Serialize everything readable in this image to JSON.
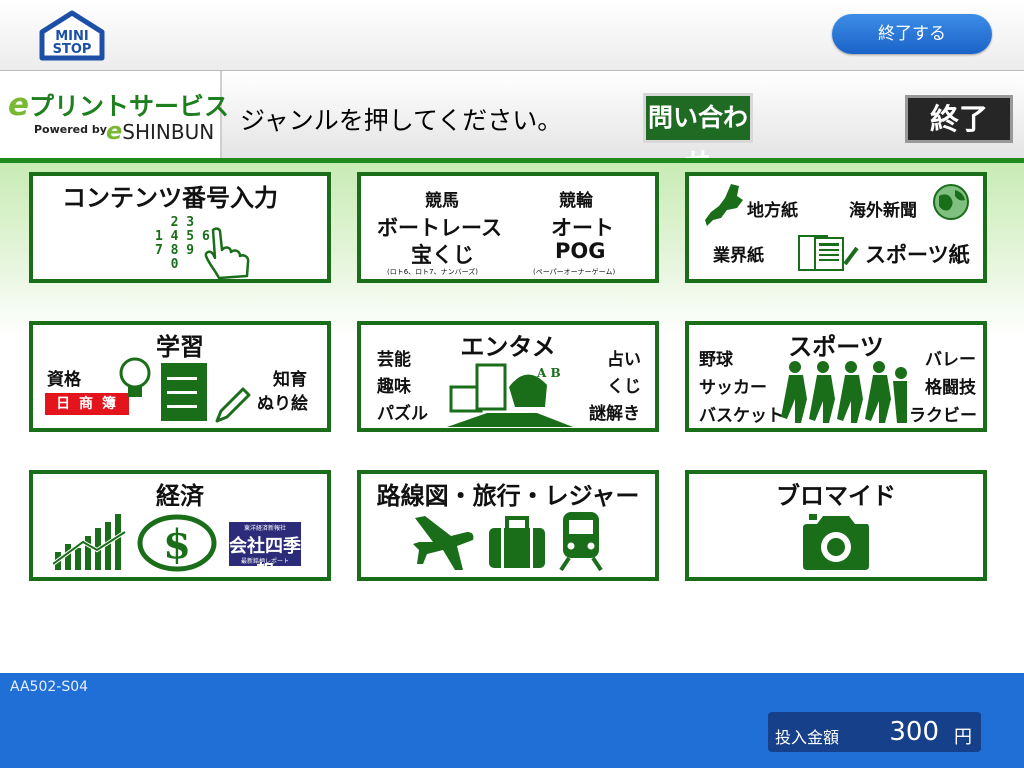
{
  "topbar": {
    "logo_line1": "MINI",
    "logo_line2": "STOP",
    "exit_button": "終了する"
  },
  "header": {
    "brand_e": "e",
    "brand_title": "プリントサービス",
    "powered_by": "Powered by",
    "partner_e": "e",
    "partner_name": "SHINBUN",
    "instruction": "ジャンルを押してください。",
    "inquiry_button": "問い合わせ",
    "end_button": "終了"
  },
  "tiles": {
    "contents_number": {
      "title": "コンテンツ番号入力",
      "digits": "1 2 3\n1 4 5 6\n7 8 9\n    0",
      "digit_rows": [
        "  2 3",
        "1 4 5 6",
        "7 8 9",
        "  0"
      ]
    },
    "keiba": {
      "items": [
        "競馬",
        "競輪",
        "ボートレース",
        "オート",
        "宝くじ",
        "POG"
      ],
      "note_takarakuji": "(ロト6、ロト7、ナンバーズ)",
      "note_pog": "(ペーパーオーナーゲーム)"
    },
    "newspaper": {
      "items": [
        "地方紙",
        "海外新聞",
        "業界紙",
        "スポーツ紙"
      ]
    },
    "study": {
      "title": "学習",
      "left": "資格",
      "badge": "日 商 簿 記",
      "right1": "知育",
      "right2": "ぬり絵"
    },
    "entame": {
      "title": "エンタメ",
      "left": [
        "芸能",
        "趣味",
        "パズル"
      ],
      "right": [
        "占い",
        "くじ",
        "謎解き"
      ]
    },
    "sports": {
      "title": "スポーツ",
      "left": [
        "野球",
        "サッカー",
        "バスケット"
      ],
      "right": [
        "バレー",
        "格闘技",
        "ラクビー"
      ]
    },
    "economy": {
      "title": "経済",
      "shikiho_top": "東洋経済新報社",
      "shikiho_title": "会社四季報",
      "shikiho_bottom": "最新銘柄レポート"
    },
    "travel": {
      "title": "路線図・旅行・レジャー"
    },
    "bromide": {
      "title": "ブロマイド"
    }
  },
  "footer": {
    "screen_id": "AA502-S04",
    "payment_label": "投入金額",
    "payment_amount": "300",
    "payment_unit": "円"
  },
  "colors": {
    "accent_green": "#1a6e1a",
    "footer_blue": "#1f6fd6",
    "payment_box": "#17408a",
    "exit_button_blue": "#2a78da",
    "boki_red": "#e3141c"
  },
  "icons": [
    "ministop-logo",
    "finger-pointing-icon",
    "japan-map-icon",
    "globe-icon",
    "newspaper-icon",
    "lightbulb-icon",
    "book-icon",
    "pencil-icon",
    "entertainment-collage-icon",
    "athletes-icon",
    "growth-chart-icon",
    "dollar-coin-icon",
    "airplane-icon",
    "suitcase-icon",
    "train-icon",
    "camera-icon"
  ]
}
